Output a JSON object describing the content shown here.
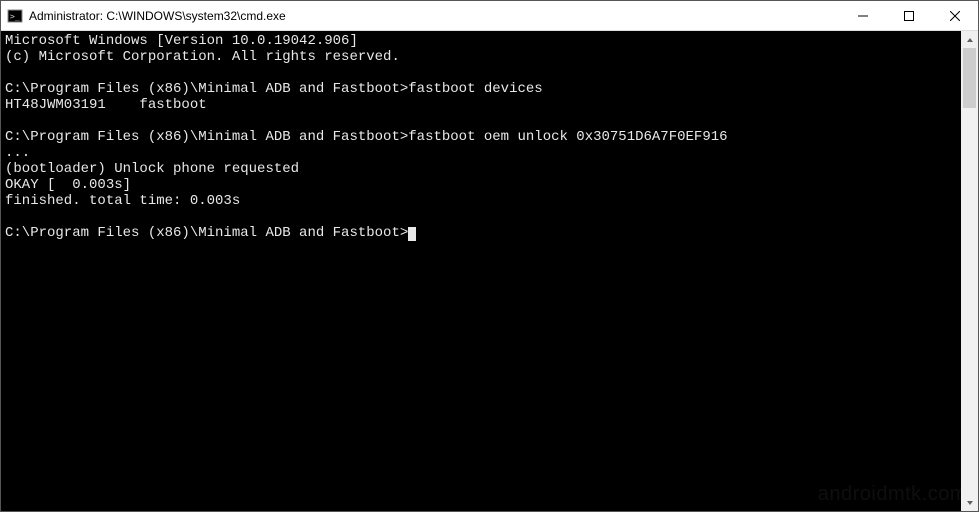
{
  "window": {
    "title": "Administrator: C:\\WINDOWS\\system32\\cmd.exe"
  },
  "console": {
    "lines": [
      "Microsoft Windows [Version 10.0.19042.906]",
      "(c) Microsoft Corporation. All rights reserved.",
      "",
      "C:\\Program Files (x86)\\Minimal ADB and Fastboot>fastboot devices",
      "HT48JWM03191    fastboot",
      "",
      "C:\\Program Files (x86)\\Minimal ADB and Fastboot>fastboot oem unlock 0x30751D6A7F0EF916",
      "...",
      "(bootloader) Unlock phone requested",
      "OKAY [  0.003s]",
      "finished. total time: 0.003s",
      ""
    ],
    "prompt": "C:\\Program Files (x86)\\Minimal ADB and Fastboot>"
  },
  "watermark": "androidmtk.com"
}
